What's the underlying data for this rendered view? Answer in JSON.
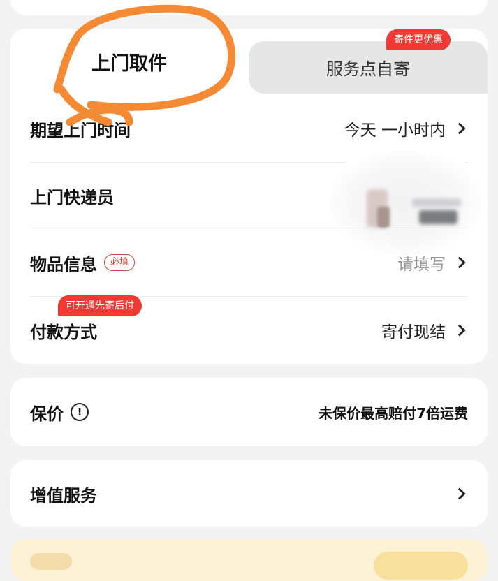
{
  "tabs": {
    "pickup_label": "上门取件",
    "self_label": "服务点自寄",
    "self_badge": "寄件更优惠"
  },
  "rows": {
    "time": {
      "label": "期望上门时间",
      "value": "今天 一小时内"
    },
    "courier": {
      "label": "上门快递员"
    },
    "item": {
      "label": "物品信息",
      "tag": "必填",
      "value": "请填写"
    },
    "payment": {
      "label": "付款方式",
      "badge": "可开通先寄后付",
      "value": "寄付现结"
    }
  },
  "insurance": {
    "label": "保价",
    "info_icon": "!",
    "value": "未保价最高赔付7倍运费"
  },
  "value_added": {
    "label": "增值服务"
  },
  "colors": {
    "accent_red": "#f03a33",
    "scribble_orange": "#f58a34",
    "tab_inactive_bg": "#e6e6e6"
  }
}
